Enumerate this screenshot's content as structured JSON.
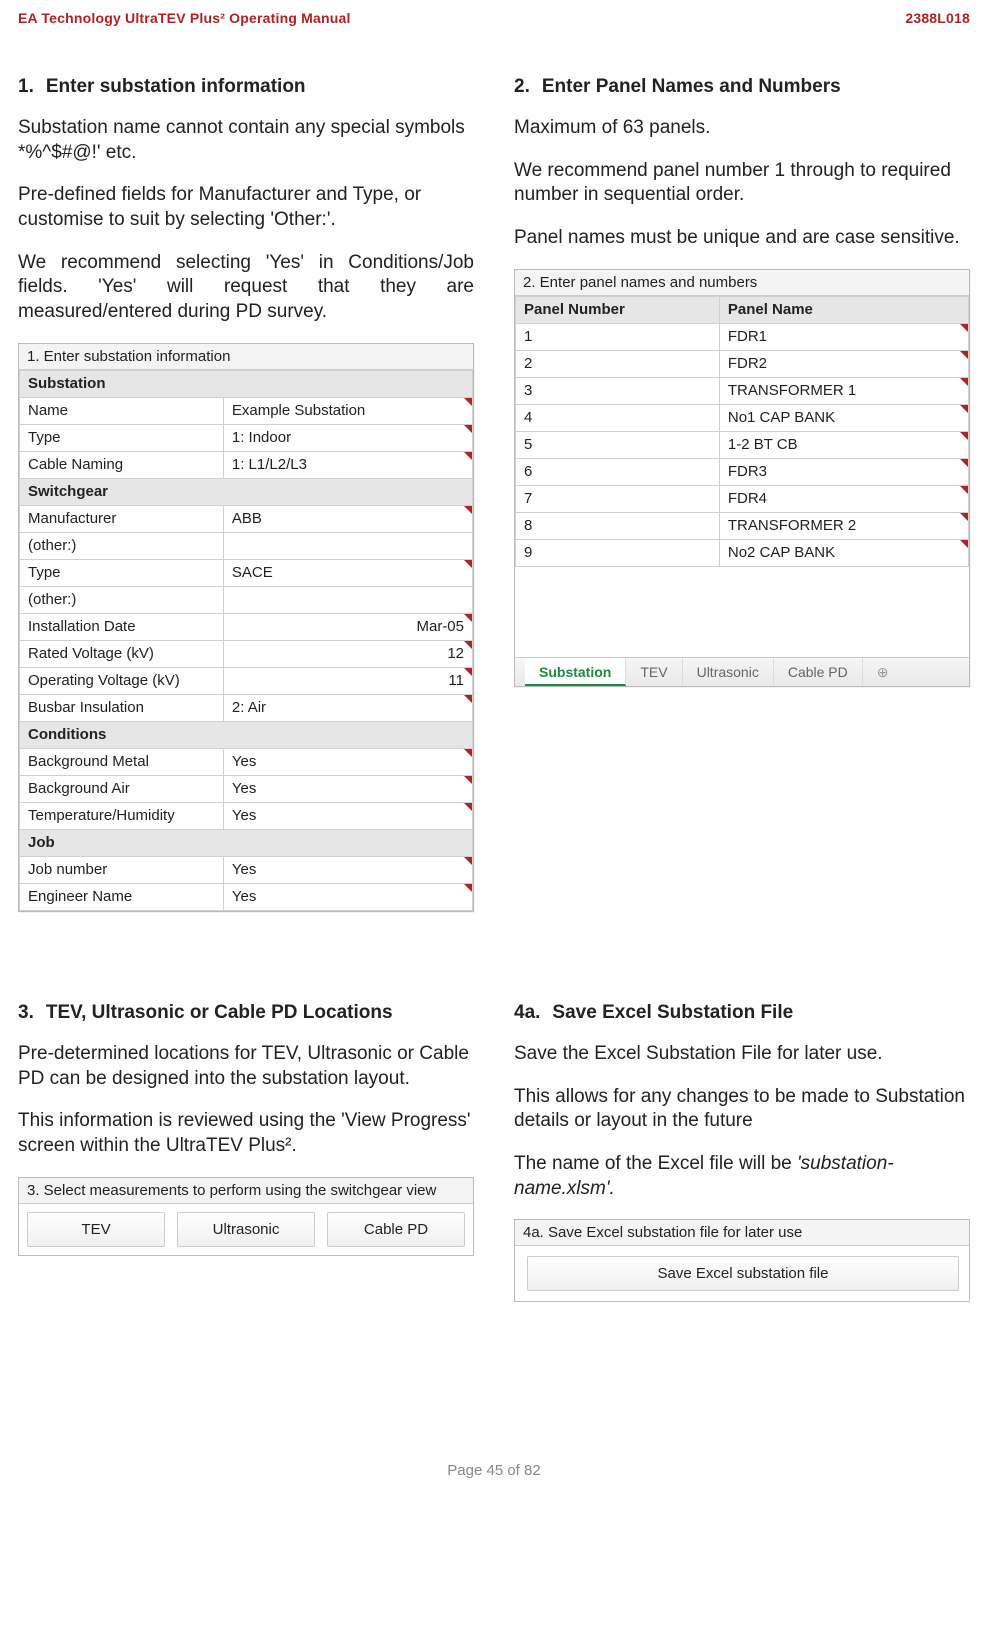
{
  "header": {
    "left": "EA Technology UltraTEV Plus² Operating Manual",
    "right": "2388L018"
  },
  "footer": "Page 45 of 82",
  "sec1": {
    "num": "1.",
    "title": "Enter substation information",
    "p1": "Substation name cannot contain any special symbols *%^$#@!' etc.",
    "p2": "Pre-defined fields for Manufacturer and Type, or customise to suit by selecting 'Other:'.",
    "p3": "We recommend selecting 'Yes' in Conditions/Job fields. 'Yes' will request that they are measured/entered during PD survey.",
    "excel": {
      "caption": "1. Enter substation information",
      "groups": {
        "substation_label": "Substation",
        "substation_rows": [
          {
            "k": "Name",
            "v": "Example Substation"
          },
          {
            "k": "Type",
            "v": "1: Indoor"
          },
          {
            "k": "Cable Naming",
            "v": "1: L1/L2/L3"
          }
        ],
        "switchgear_label": "Switchgear",
        "switchgear_rows": [
          {
            "k": "Manufacturer",
            "v": "ABB"
          },
          {
            "k": "(other:)",
            "v": ""
          },
          {
            "k": "Type",
            "v": "SACE"
          },
          {
            "k": "(other:)",
            "v": ""
          },
          {
            "k": "Installation Date",
            "v": "Mar-05",
            "right": true
          },
          {
            "k": "Rated Voltage (kV)",
            "v": "12",
            "right": true
          },
          {
            "k": "Operating Voltage (kV)",
            "v": "11",
            "right": true
          },
          {
            "k": "Busbar Insulation",
            "v": "2: Air"
          }
        ],
        "conditions_label": "Conditions",
        "conditions_rows": [
          {
            "k": "Background Metal",
            "v": "Yes"
          },
          {
            "k": "Background Air",
            "v": "Yes"
          },
          {
            "k": "Temperature/Humidity",
            "v": "Yes"
          }
        ],
        "job_label": "Job",
        "job_rows": [
          {
            "k": "Job number",
            "v": "Yes"
          },
          {
            "k": "Engineer Name",
            "v": "Yes"
          }
        ]
      }
    }
  },
  "sec2": {
    "num": "2.",
    "title": "Enter Panel Names and Numbers",
    "p1": "Maximum of 63 panels.",
    "p2": "We recommend panel number 1 through to required number in sequential order.",
    "p3": "Panel names must be unique and are case sensitive.",
    "excel": {
      "caption": "2. Enter panel names and numbers",
      "headers": [
        "Panel Number",
        "Panel Name"
      ],
      "rows": [
        [
          "1",
          "FDR1"
        ],
        [
          "2",
          "FDR2"
        ],
        [
          "3",
          "TRANSFORMER 1"
        ],
        [
          "4",
          "No1 CAP BANK"
        ],
        [
          "5",
          "1-2 BT CB"
        ],
        [
          "6",
          "FDR3"
        ],
        [
          "7",
          "FDR4"
        ],
        [
          "8",
          "TRANSFORMER 2"
        ],
        [
          "9",
          "No2 CAP BANK"
        ]
      ],
      "tabs": [
        "Substation",
        "TEV",
        "Ultrasonic",
        "Cable PD"
      ],
      "plus": "⊕"
    }
  },
  "sec3": {
    "num": "3.",
    "title": "TEV, Ultrasonic or Cable PD Locations",
    "p1": "Pre-determined locations for TEV, Ultrasonic or Cable PD can be designed into the substation layout.",
    "p2": "This information is reviewed using the 'View Progress' screen within the UltraTEV Plus².",
    "widget": {
      "caption": "3. Select measurements to perform using the switchgear view",
      "buttons": [
        "TEV",
        "Ultrasonic",
        "Cable PD"
      ]
    }
  },
  "sec4": {
    "num": "4a.",
    "title": "Save Excel Substation File",
    "p1": "Save the Excel Substation File for later use.",
    "p2": "This allows for any changes to be made to Substation details or layout in the future",
    "p3a": "The name of the Excel file will be ",
    "p3b": "'substation-name.xlsm'.",
    "widget": {
      "caption": "4a. Save Excel substation file for later use",
      "button": "Save Excel substation file"
    }
  }
}
